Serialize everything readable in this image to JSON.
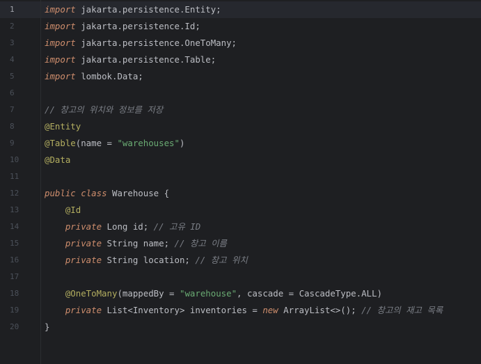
{
  "editor": {
    "lines": [
      {
        "n": "1",
        "tokens": [
          {
            "t": "import",
            "c": "kw"
          },
          {
            "t": " jakarta.persistence.Entity;",
            "c": "cls"
          }
        ]
      },
      {
        "n": "2",
        "tokens": [
          {
            "t": "import",
            "c": "kw"
          },
          {
            "t": " jakarta.persistence.Id;",
            "c": "cls"
          }
        ]
      },
      {
        "n": "3",
        "tokens": [
          {
            "t": "import",
            "c": "kw"
          },
          {
            "t": " jakarta.persistence.OneToMany;",
            "c": "cls"
          }
        ]
      },
      {
        "n": "4",
        "tokens": [
          {
            "t": "import",
            "c": "kw"
          },
          {
            "t": " jakarta.persistence.Table;",
            "c": "cls"
          }
        ]
      },
      {
        "n": "5",
        "tokens": [
          {
            "t": "import",
            "c": "kw"
          },
          {
            "t": " lombok.Data;",
            "c": "cls"
          }
        ]
      },
      {
        "n": "6",
        "tokens": []
      },
      {
        "n": "7",
        "tokens": [
          {
            "t": "// 창고의 위치와 정보를 저장",
            "c": "cm"
          }
        ]
      },
      {
        "n": "8",
        "tokens": [
          {
            "t": "@Entity",
            "c": "ann"
          }
        ]
      },
      {
        "n": "9",
        "tokens": [
          {
            "t": "@Table",
            "c": "ann"
          },
          {
            "t": "(name = ",
            "c": "cls"
          },
          {
            "t": "\"warehouses\"",
            "c": "str"
          },
          {
            "t": ")",
            "c": "cls"
          }
        ]
      },
      {
        "n": "10",
        "tokens": [
          {
            "t": "@Data",
            "c": "ann"
          }
        ]
      },
      {
        "n": "11",
        "tokens": []
      },
      {
        "n": "12",
        "tokens": [
          {
            "t": "public",
            "c": "kw"
          },
          {
            "t": " ",
            "c": "cls"
          },
          {
            "t": "class",
            "c": "kw"
          },
          {
            "t": " Warehouse {",
            "c": "cls"
          }
        ]
      },
      {
        "n": "13",
        "tokens": [
          {
            "t": "    ",
            "c": "cls"
          },
          {
            "t": "@Id",
            "c": "ann"
          }
        ]
      },
      {
        "n": "14",
        "tokens": [
          {
            "t": "    ",
            "c": "cls"
          },
          {
            "t": "private",
            "c": "kw"
          },
          {
            "t": " Long id; ",
            "c": "cls"
          },
          {
            "t": "// 고유 ID",
            "c": "cm"
          }
        ]
      },
      {
        "n": "15",
        "tokens": [
          {
            "t": "    ",
            "c": "cls"
          },
          {
            "t": "private",
            "c": "kw"
          },
          {
            "t": " String name; ",
            "c": "cls"
          },
          {
            "t": "// 창고 이름",
            "c": "cm"
          }
        ]
      },
      {
        "n": "16",
        "tokens": [
          {
            "t": "    ",
            "c": "cls"
          },
          {
            "t": "private",
            "c": "kw"
          },
          {
            "t": " String location; ",
            "c": "cls"
          },
          {
            "t": "// 창고 위치",
            "c": "cm"
          }
        ]
      },
      {
        "n": "17",
        "tokens": []
      },
      {
        "n": "18",
        "tokens": [
          {
            "t": "    ",
            "c": "cls"
          },
          {
            "t": "@OneToMany",
            "c": "ann"
          },
          {
            "t": "(mappedBy = ",
            "c": "cls"
          },
          {
            "t": "\"warehouse\"",
            "c": "str"
          },
          {
            "t": ", cascade = CascadeType.ALL)",
            "c": "cls"
          }
        ]
      },
      {
        "n": "19",
        "tokens": [
          {
            "t": "    ",
            "c": "cls"
          },
          {
            "t": "private",
            "c": "kw"
          },
          {
            "t": " List<Inventory> inventories = ",
            "c": "cls"
          },
          {
            "t": "new",
            "c": "kw"
          },
          {
            "t": " ArrayList<>(); ",
            "c": "cls"
          },
          {
            "t": "// 창고의 재고 목록",
            "c": "cm"
          }
        ]
      },
      {
        "n": "20",
        "tokens": [
          {
            "t": "}",
            "c": "cls"
          }
        ]
      }
    ],
    "current_line": "1"
  }
}
